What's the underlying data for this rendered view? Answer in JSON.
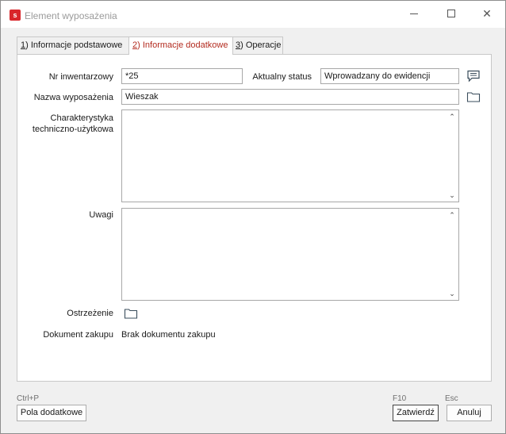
{
  "window": {
    "title": "Element wyposażenia",
    "app_icon_letter": "s",
    "accent": "#d9262b"
  },
  "tabs": [
    {
      "key": "1",
      "label": ") Informacje podstawowe",
      "active": false
    },
    {
      "key": "2",
      "label": ") Informacje dodatkowe",
      "active": true
    },
    {
      "key": "3",
      "label": ") Operacje",
      "active": false
    }
  ],
  "form": {
    "nr_inwentarzowy": {
      "label": "Nr inwentarzowy",
      "value": "*25"
    },
    "aktualny_status": {
      "label": "Aktualny status",
      "value": "Wprowadzany do ewidencji"
    },
    "nazwa": {
      "label": "Nazwa wyposażenia",
      "value": "Wieszak"
    },
    "charakterystyka": {
      "label_line1": "Charakterystyka",
      "label_line2": "techniczno-użytkowa",
      "value": ""
    },
    "uwagi": {
      "label": "Uwagi",
      "value": ""
    },
    "ostrzezenie": {
      "label": "Ostrzeżenie"
    },
    "dokument_zakupu": {
      "label": "Dokument zakupu",
      "value": "Brak dokumentu zakupu"
    }
  },
  "footer": {
    "pola_hint": "Ctrl+P",
    "pola_label": "Pola dodatkowe",
    "zatwierdz_hint": "F10",
    "zatwierdz_label": "Zatwierdź",
    "anuluj_hint": "Esc",
    "anuluj_label": "Anuluj"
  },
  "icons": {
    "status_note": "speech-bubble-icon",
    "folder": "folder-icon"
  }
}
